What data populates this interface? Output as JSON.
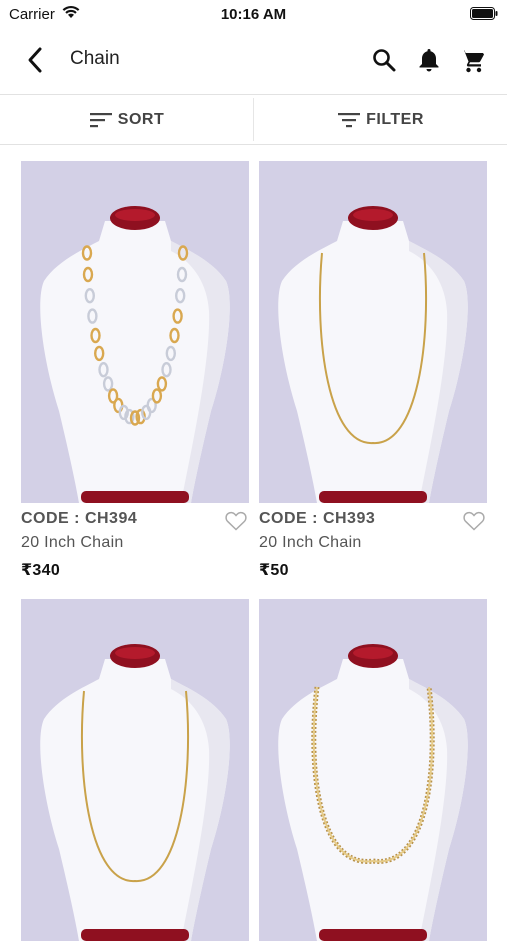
{
  "status_bar": {
    "carrier": "Carrier",
    "time": "10:16 AM"
  },
  "header": {
    "title": "Chain"
  },
  "sort_bar": {
    "sort_label": "SORT",
    "filter_label": "FILTER"
  },
  "products": [
    {
      "code": "CODE : CH394",
      "name": "20 Inch Chain",
      "price": "₹340",
      "chain_style": "two-tone-link"
    },
    {
      "code": "CODE : CH393",
      "name": "20 Inch Chain",
      "price": "₹50",
      "chain_style": "thin-gold"
    },
    {
      "code": "",
      "name": "",
      "price": "",
      "chain_style": "thin-gold"
    },
    {
      "code": "",
      "name": "",
      "price": "",
      "chain_style": "textured-gold"
    }
  ],
  "colors": {
    "photo_background": "#d3d0e6",
    "bust": "#f7f7fb",
    "velvet": "#8f1020",
    "gold": "#c9a24a"
  }
}
